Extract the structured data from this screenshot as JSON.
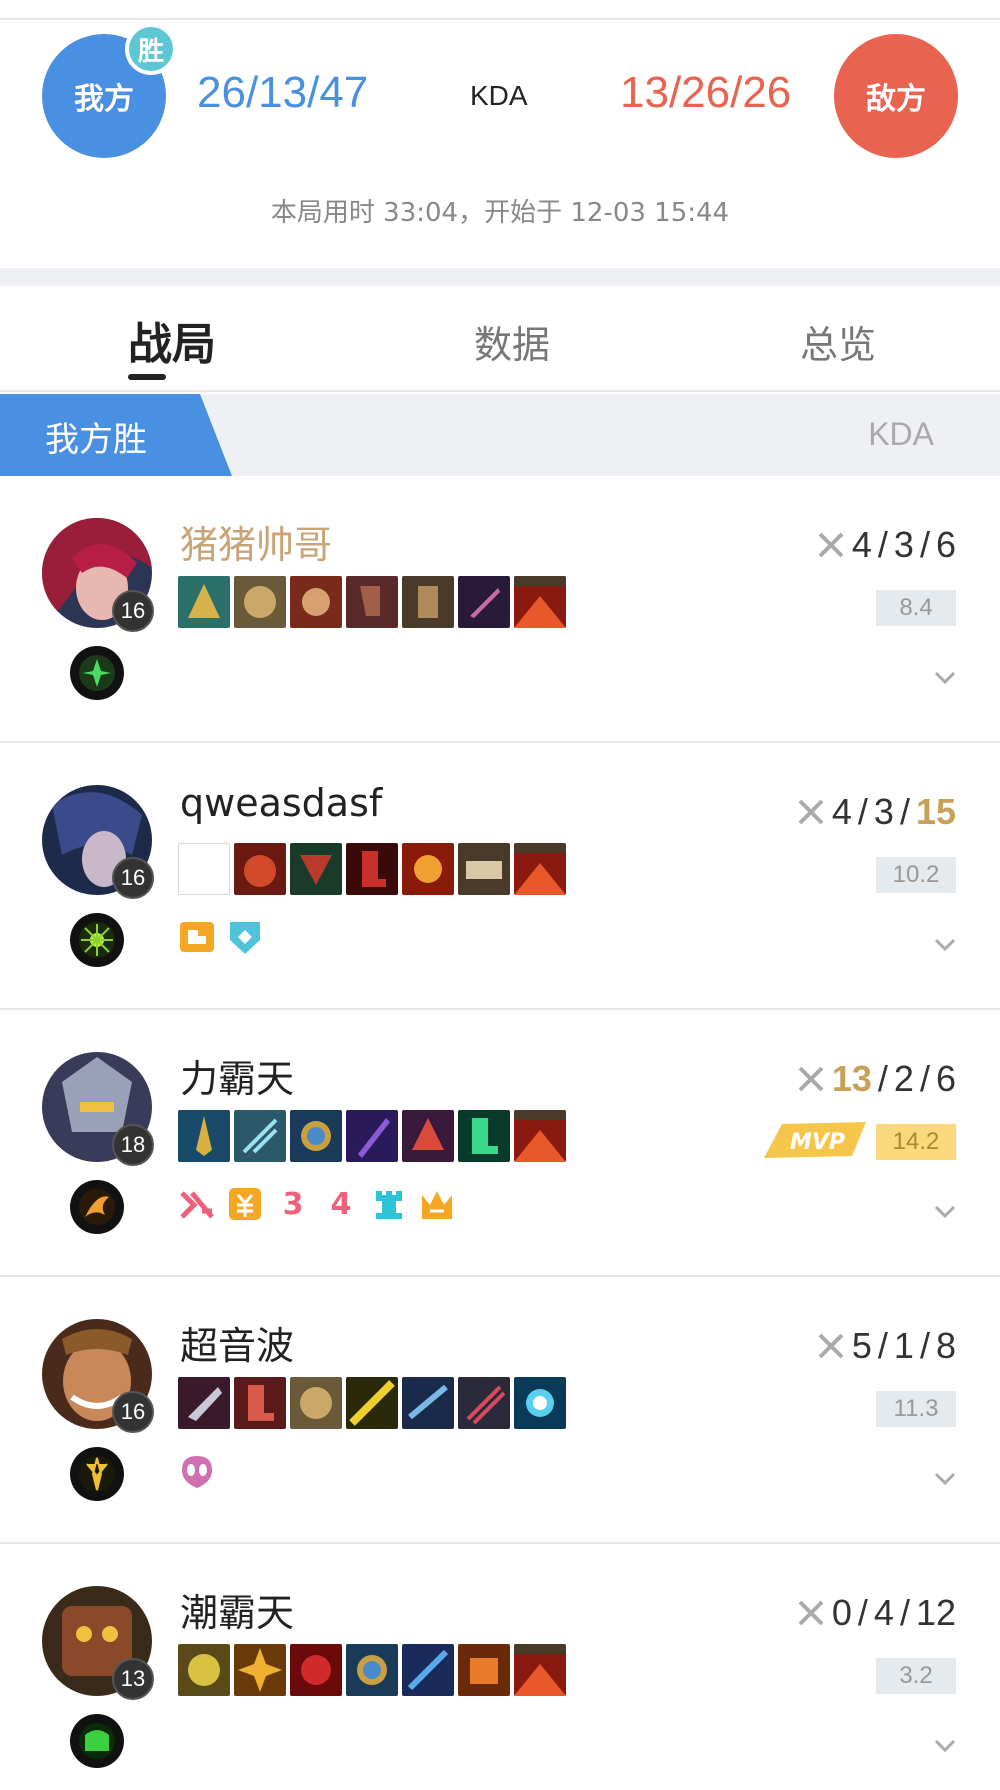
{
  "header": {
    "our_team_label": "我方",
    "win_badge": "胜",
    "our_score": "26/13/47",
    "kda_label": "KDA",
    "enemy_score": "13/26/26",
    "enemy_team_label": "敌方",
    "match_info": "本局用时 33:04，开始于 12-03 15:44",
    "colors": {
      "ours": "#4a90e2",
      "enemy": "#e96351",
      "win_badge": "#5fc6d6"
    }
  },
  "tabs": [
    {
      "label": "战局",
      "active": true
    },
    {
      "label": "数据",
      "active": false
    },
    {
      "label": "总览",
      "active": false
    }
  ],
  "result_bar": {
    "label": "我方胜",
    "kda_header": "KDA"
  },
  "players": [
    {
      "name": "猪猪帅哥",
      "level": "16",
      "kda_k": "4",
      "kda_d": "3",
      "kda_a": "6",
      "rating": "8.4",
      "mvp": false,
      "name_highlight": true,
      "rune_icon": "rune-green-leaf-icon"
    },
    {
      "name": "qweasdasf",
      "level": "16",
      "kda_k": "4",
      "kda_d": "3",
      "kda_a": "15",
      "rating": "10.2",
      "mvp": false,
      "name_highlight": false,
      "rune_icon": "rune-green-burst-icon"
    },
    {
      "name": "力霸天",
      "level": "18",
      "kda_k": "13",
      "kda_d": "2",
      "kda_a": "6",
      "rating": "14.2",
      "mvp": true,
      "mvp_label": "MVP",
      "name_highlight": false,
      "rune_icon": "rune-orange-wing-icon"
    },
    {
      "name": "超音波",
      "level": "16",
      "kda_k": "5",
      "kda_d": "1",
      "kda_a": "8",
      "rating": "11.3",
      "mvp": false,
      "name_highlight": false,
      "rune_icon": "rune-gold-spike-icon"
    },
    {
      "name": "潮霸天",
      "level": "13",
      "kda_k": "0",
      "kda_d": "4",
      "kda_a": "12",
      "rating": "3.2",
      "mvp": false,
      "name_highlight": false,
      "rune_icon": "rune-green-shield-icon"
    }
  ],
  "honor_badges": {
    "p2": [
      "fist-badge-icon",
      "shield-badge-icon"
    ],
    "p3": [
      "triple-kill-badge-icon",
      "gold-badge-icon",
      "3-badge",
      "4-badge",
      "tower-badge-icon",
      "crown-badge-icon"
    ],
    "p4": [
      "alien-badge-icon"
    ],
    "p3_digits": {
      "three": "3",
      "four": "4"
    }
  }
}
